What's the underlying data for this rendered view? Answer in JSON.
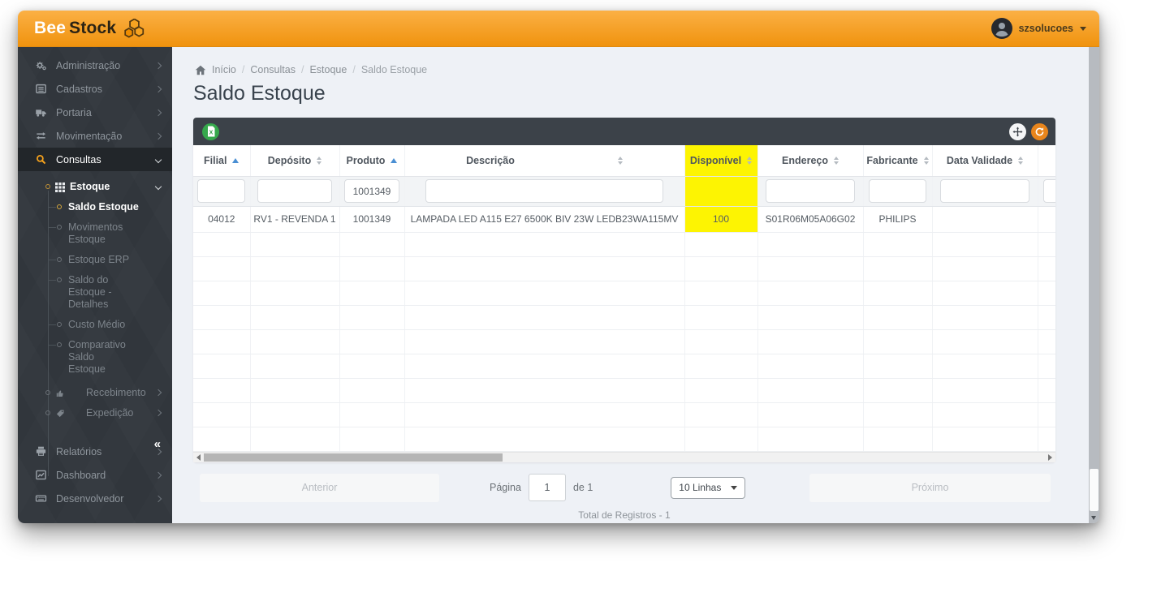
{
  "header": {
    "brand_bee": "Bee",
    "brand_stock": "Stock",
    "username": "szsolucoes"
  },
  "sidebar": {
    "items": [
      {
        "label": "Administração",
        "icon": "gears-icon"
      },
      {
        "label": "Cadastros",
        "icon": "list-icon"
      },
      {
        "label": "Portaria",
        "icon": "truck-icon"
      },
      {
        "label": "Movimentação",
        "icon": "transfer-icon"
      },
      {
        "label": "Consultas",
        "icon": "search-icon",
        "active": true
      }
    ],
    "estoque_group": {
      "label": "Estoque",
      "children": [
        {
          "label": "Saldo Estoque",
          "active": true
        },
        {
          "label": "Movimentos Estoque"
        },
        {
          "label": "Estoque ERP"
        },
        {
          "label": "Saldo do Estoque - Detalhes"
        },
        {
          "label": "Custo Médio"
        },
        {
          "label": "Comparativo Saldo Estoque"
        }
      ]
    },
    "groups": [
      {
        "label": "Recebimento",
        "icon": "thumbs-up-icon"
      },
      {
        "label": "Expedição",
        "icon": "tag-icon"
      }
    ],
    "bottom_items": [
      {
        "label": "Relatórios",
        "icon": "printer-icon"
      },
      {
        "label": "Dashboard",
        "icon": "chart-icon"
      },
      {
        "label": "Desenvolvedor",
        "icon": "keyboard-icon"
      }
    ],
    "collapse_label": "«"
  },
  "breadcrumb": {
    "items": [
      "Início",
      "Consultas",
      "Estoque",
      "Saldo Estoque"
    ]
  },
  "page": {
    "title": "Saldo Estoque"
  },
  "table": {
    "columns": [
      {
        "label": "Filial",
        "sort": "asc"
      },
      {
        "label": "Depósito",
        "sort": "none"
      },
      {
        "label": "Produto",
        "sort": "asc"
      },
      {
        "label": "Descrição",
        "sort": "none"
      },
      {
        "label": "Disponível",
        "sort": "none",
        "highlighted": true
      },
      {
        "label": "Endereço",
        "sort": "none"
      },
      {
        "label": "Fabricante",
        "sort": "none"
      },
      {
        "label": "Data Validade",
        "sort": "none"
      }
    ],
    "filters": {
      "produto": "1001349"
    },
    "row": {
      "filial": "04012",
      "deposito": "RV1 - REVENDA 1",
      "produto": "1001349",
      "descricao": "LAMPADA LED A115 E27 6500K BIV 23W LEDB23WA115MV",
      "disponivel": "100",
      "endereco": "S01R06M05A06G02",
      "fabricante": "PHILIPS",
      "data_validade": ""
    }
  },
  "pagination": {
    "prev_label": "Anterior",
    "page_label": "Página",
    "page_value": "1",
    "of_label": "de 1",
    "rows_select": "10 Linhas",
    "next_label": "Próximo",
    "total_label": "Total de Registros - 1"
  },
  "colors": {
    "header_orange": "#f0930e",
    "highlight_yellow": "#fdf402",
    "excel_green": "#36a84c",
    "refresh_orange": "#e8851c",
    "sort_blue": "#4a8fd3",
    "sidebar_dark": "#31363c"
  }
}
